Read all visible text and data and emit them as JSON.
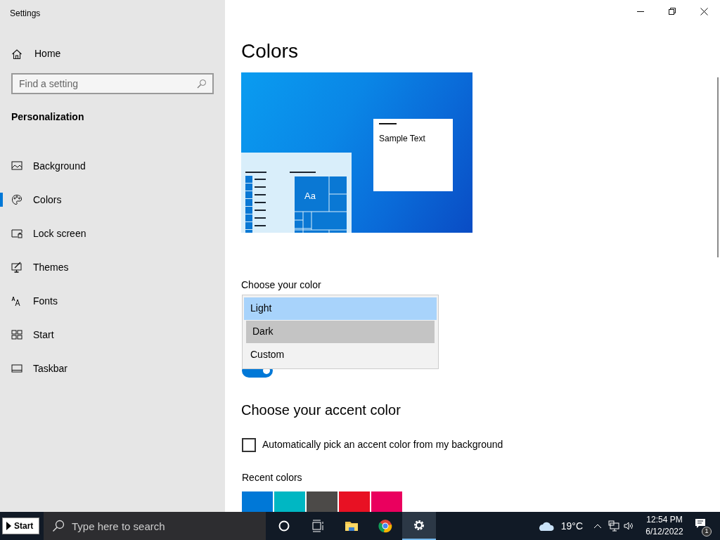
{
  "window": {
    "title": "Settings"
  },
  "sidebar": {
    "home": "Home",
    "search": {
      "placeholder": "Find a setting"
    },
    "section": "Personalization",
    "items": [
      {
        "label": "Background",
        "selected": false
      },
      {
        "label": "Colors",
        "selected": true
      },
      {
        "label": "Lock screen",
        "selected": false
      },
      {
        "label": "Themes",
        "selected": false
      },
      {
        "label": "Fonts",
        "selected": false
      },
      {
        "label": "Start",
        "selected": false
      },
      {
        "label": "Taskbar",
        "selected": false
      }
    ]
  },
  "main": {
    "title": "Colors",
    "preview": {
      "sample_text": "Sample Text",
      "tile_text": "Aa"
    },
    "color_label": "Choose your color",
    "color_menu": [
      {
        "label": "Light",
        "selected": true,
        "hovered": false
      },
      {
        "label": "Dark",
        "selected": false,
        "hovered": true
      },
      {
        "label": "Custom",
        "selected": false,
        "hovered": false
      }
    ],
    "toggle": {
      "on": true
    },
    "accent_title": "Choose your accent color",
    "auto_accent": {
      "label": "Automatically pick an accent color from my background",
      "checked": false
    },
    "recent_label": "Recent colors",
    "recent_colors": [
      {
        "color": "#0078d7"
      },
      {
        "color": "#00b7c3"
      },
      {
        "color": "#4c4a48"
      },
      {
        "color": "#e81123"
      },
      {
        "color": "#ea005e"
      }
    ]
  },
  "taskbar": {
    "start": "Start",
    "search": {
      "placeholder": "Type here to search"
    },
    "apps": [
      {
        "active": false
      },
      {
        "active": false
      },
      {
        "active": false
      },
      {
        "active": false
      },
      {
        "active": true
      }
    ],
    "weather": "19°C",
    "time": "12:54 PM",
    "date": "6/12/2022",
    "notifications": "1"
  }
}
